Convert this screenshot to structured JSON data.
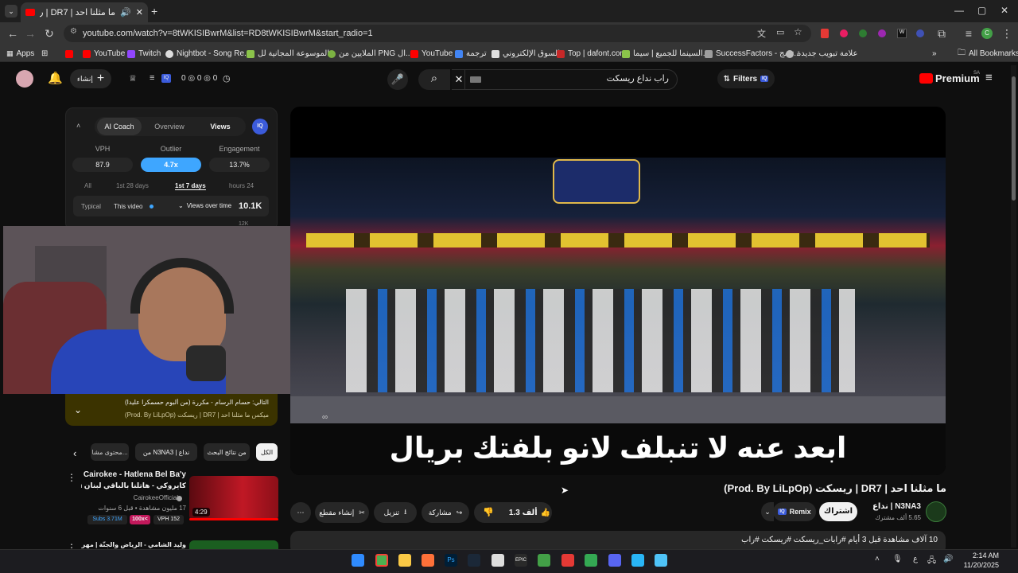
{
  "tab": {
    "title": "ما مثلنا احد | DR7 | ريسكت"
  },
  "url": "youtube.com/watch?v=8tWKISIBwrM&list=RD8tWKISIBwrM&start_radio=1",
  "bookmarks": [
    "Apps",
    "YouTube",
    "Twitch",
    "Nightbot - Song Re...",
    "الموسوعة المجانية لل...",
    "الملايين من PNG ال...",
    "YouTube",
    "ترجمة",
    "السوق الإلكتروني",
    "Top | dafont.com",
    "السينما للجميع | سيما...",
    "SuccessFactors - تسج...",
    "علامة تبويب جديدة"
  ],
  "all_bookmarks": "All Bookmarks",
  "header": {
    "create_label": "إنشاء",
    "search_query": "راب نداع ريسكت",
    "filters_label": "Filters",
    "premium_label": "Premium",
    "region": "SA",
    "counter_text": "0 ◎ 0 ◎ 0"
  },
  "coach": {
    "tabs": [
      "AI Coach",
      "Overview",
      "Views"
    ],
    "metrics": [
      {
        "label": "VPH",
        "value": "87.9"
      },
      {
        "label": "Outlier",
        "value": "4.7x"
      },
      {
        "label": "Engagement",
        "value": "13.7%"
      }
    ],
    "ranges": [
      "All",
      "1st 28 days",
      "1st 7 days",
      "hours 24"
    ],
    "typical": "Typical",
    "this_video": "This video",
    "views_over_time": "Views over time",
    "views_value": "10.1K",
    "axis_tick": "12K"
  },
  "queue": {
    "line1": "التالي: حسام الرسام - مكررة (من ألبوم حسمكرا عليدا)",
    "line2": "ميكس ما مثلنا احد | DR7 | ريسكت (Prod. By LiLpOp)"
  },
  "chips": [
    "الكل",
    "من نتائج البحث",
    "من N3NA3 | نداع",
    "محتوى مشا..."
  ],
  "related": {
    "title": "Cairokee - Hatlena Bel Ba'y",
    "subtitle": "كايروكي - هاتلنا بالباقي لبنان Leban",
    "channel": "CairokeeOfficial",
    "meta": "17 مليون مشاهدة • قبل 6 سنوات",
    "duration": "4:29",
    "badges": [
      "Subs 3.71M",
      "100x<",
      "VPH 152"
    ],
    "next_title": "وليد الشامي - الرياض والجنّة | مهرجان بين"
  },
  "video": {
    "caption": "ابعد عنه لا تنبلف لانو بلفتك بريال",
    "title": "ما مثلنا احد | DR7 | ريسكت (Prod. By LiLpOp)"
  },
  "channel": {
    "name": "N3NA3 | نداع",
    "subs": "5.65 ألف مشترك",
    "subscribe": "اشتراك",
    "remix": "Remix"
  },
  "actions": {
    "likes": "1.3 ألف",
    "share": "مشاركة",
    "download": "تنزيل",
    "clip": "إنشاء مقطع"
  },
  "description": "10 آلاف مشاهدة قبل 3 أيام #رابات_ريسكت #ريسكت #راب",
  "taskbar": {
    "time": "2:14 AM",
    "date": "11/20/2025",
    "lang": "ع"
  },
  "colors": {
    "accent_blue": "#3ea6ff",
    "yt_red": "#ff0000",
    "bg": "#0f0f0f"
  }
}
